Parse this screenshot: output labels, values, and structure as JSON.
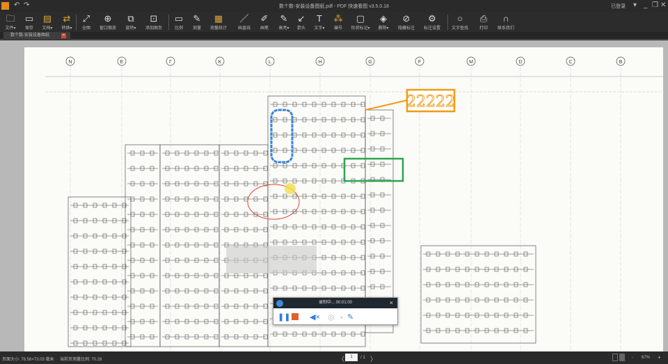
{
  "app": {
    "logo_text": "看图",
    "title": "数个数-安装设备图纸.pdf - PDF 快速看图 v3.5.0.18",
    "login": "已登录"
  },
  "toolbar": [
    {
      "label": "文件▾",
      "icon": "folder-icon",
      "glyph": "🗀"
    },
    {
      "label": "保存",
      "icon": "save-icon",
      "glyph": "▭"
    },
    {
      "label": "文档▾",
      "icon": "document-icon",
      "glyph": "▤"
    },
    {
      "label": "转换▾",
      "icon": "convert-icon",
      "glyph": "⇄"
    },
    {
      "label": "全图",
      "icon": "fullscreen-icon",
      "glyph": "⤢"
    },
    {
      "label": "窗口缩放",
      "icon": "zoom-window-icon",
      "glyph": "⊕"
    },
    {
      "label": "旋转▾",
      "icon": "rotate-icon",
      "glyph": "⧉"
    },
    {
      "label": "添加图页",
      "icon": "add-page-icon",
      "glyph": "⊡"
    },
    {
      "label": "比例",
      "icon": "scale-icon",
      "glyph": "▭"
    },
    {
      "label": "测量",
      "icon": "measure-icon",
      "glyph": "✎"
    },
    {
      "label": "测量统计",
      "icon": "measure-stats-icon",
      "glyph": "▦"
    },
    {
      "label": "画直线",
      "icon": "line-icon",
      "glyph": "／"
    },
    {
      "label": "画笔",
      "icon": "pen-icon",
      "glyph": "✐"
    },
    {
      "label": "高亮▾",
      "icon": "highlight-icon",
      "glyph": "✎"
    },
    {
      "label": "箭头",
      "icon": "arrow-icon",
      "glyph": "↙"
    },
    {
      "label": "文字▾",
      "icon": "text-icon",
      "glyph": "T"
    },
    {
      "label": "编号",
      "icon": "number-icon",
      "glyph": "⁂"
    },
    {
      "label": "形状标记▾",
      "icon": "shape-icon",
      "glyph": "▢"
    },
    {
      "label": "删除▾",
      "icon": "eraser-icon",
      "glyph": "◈"
    },
    {
      "label": "隐藏标注",
      "icon": "hide-icon",
      "glyph": "⊘"
    },
    {
      "label": "标注设置",
      "icon": "annotation-settings-icon",
      "glyph": "⚙"
    },
    {
      "label": "文字查找",
      "icon": "search-icon",
      "glyph": "○"
    },
    {
      "label": "打印",
      "icon": "print-icon",
      "glyph": "⎙"
    },
    {
      "label": "联系我们",
      "icon": "headset-icon",
      "glyph": "∩"
    }
  ],
  "tab": {
    "label": "数个数-安装设备图纸",
    "close": "×"
  },
  "drawing": {
    "column_labels": [
      "N",
      "E",
      "Γ",
      "K",
      "L",
      "H",
      "G",
      "F",
      "M",
      "D",
      "C",
      "B"
    ],
    "annotation_text": "22222",
    "annotation_colors": {
      "text_box": "#f29a12",
      "cloud": "#3a86d8",
      "rect": "#2fa352",
      "ellipse": "#e0453a",
      "highlight": "#f3e04a"
    }
  },
  "recorder": {
    "status": "录制中... 00:01:00",
    "close": "×"
  },
  "status": {
    "page_size": "页面大小: 78.56×73.03 毫米",
    "scale": "当前页测量比例: 70.28",
    "current_page": "1",
    "total_pages": "/ 1",
    "prev": "〈",
    "next": "〉",
    "zoom": "67%",
    "zoom_out": "-",
    "zoom_in": "+"
  }
}
